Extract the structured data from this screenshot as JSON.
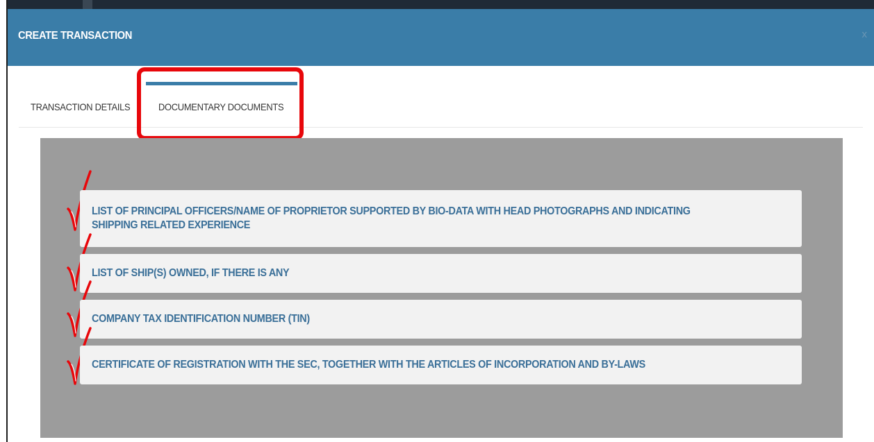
{
  "modal": {
    "title": "CREATE TRANSACTION",
    "close_label": "x"
  },
  "tabs": [
    {
      "label": "TRANSACTION DETAILS",
      "active": false
    },
    {
      "label": "DOCUMENTARY DOCUMENTS",
      "active": true
    }
  ],
  "documents": {
    "items": [
      {
        "label": "LIST OF PRINCIPAL OFFICERS/NAME OF PROPRIETOR SUPPORTED BY BIO-DATA WITH HEAD PHOTOGRAPHS AND INDICATING SHIPPING RELATED EXPERIENCE",
        "checked": true
      },
      {
        "label": "LIST OF SHIP(S) OWNED, IF THERE IS ANY",
        "checked": true
      },
      {
        "label": "COMPANY TAX IDENTIFICATION NUMBER (TIN)",
        "checked": true
      },
      {
        "label": "CERTIFICATE OF REGISTRATION WITH THE SEC, TOGETHER WITH THE ARTICLES OF INCORPORATION AND BY-LAWS",
        "checked": true
      }
    ]
  },
  "colors": {
    "header": "#3a7da8",
    "panel": "#9c9c9c",
    "item_text": "#3a6f98",
    "highlight": "#e8070b",
    "checkmark": "#e8070b"
  },
  "icons": {
    "check": "red-checkmark-icon",
    "close": "close-icon"
  }
}
